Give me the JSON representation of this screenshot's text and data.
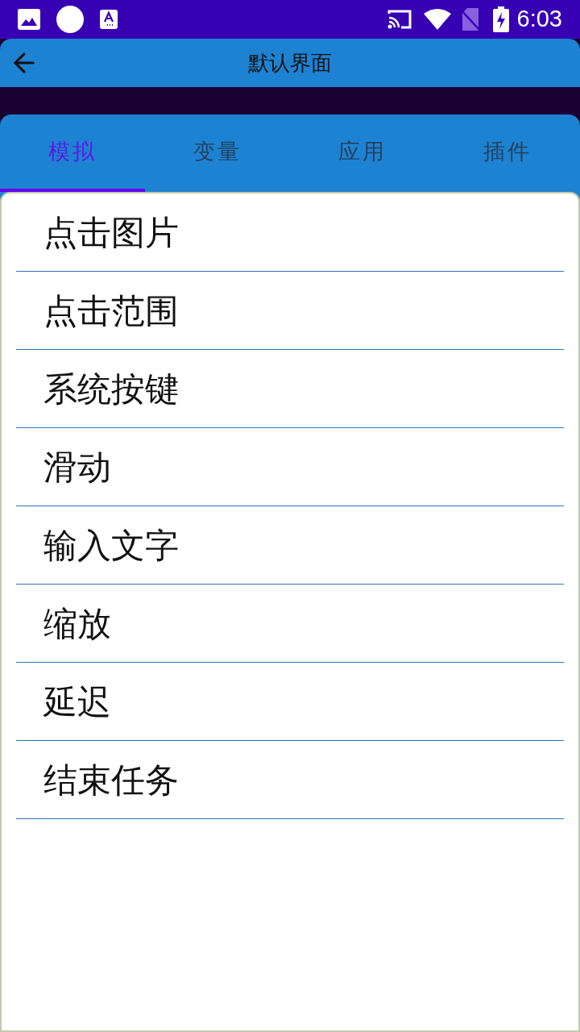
{
  "status_bar": {
    "time": "6:03"
  },
  "app_bar": {
    "title": "默认界面"
  },
  "tabs": [
    {
      "label": "模拟",
      "selected": true
    },
    {
      "label": "变量",
      "selected": false
    },
    {
      "label": "应用",
      "selected": false
    },
    {
      "label": "插件",
      "selected": false
    }
  ],
  "actions": [
    {
      "label": "点击图片"
    },
    {
      "label": "点击范围"
    },
    {
      "label": "系统按键"
    },
    {
      "label": "滑动"
    },
    {
      "label": "输入文字"
    },
    {
      "label": "缩放"
    },
    {
      "label": "延迟"
    },
    {
      "label": "结束任务"
    }
  ]
}
